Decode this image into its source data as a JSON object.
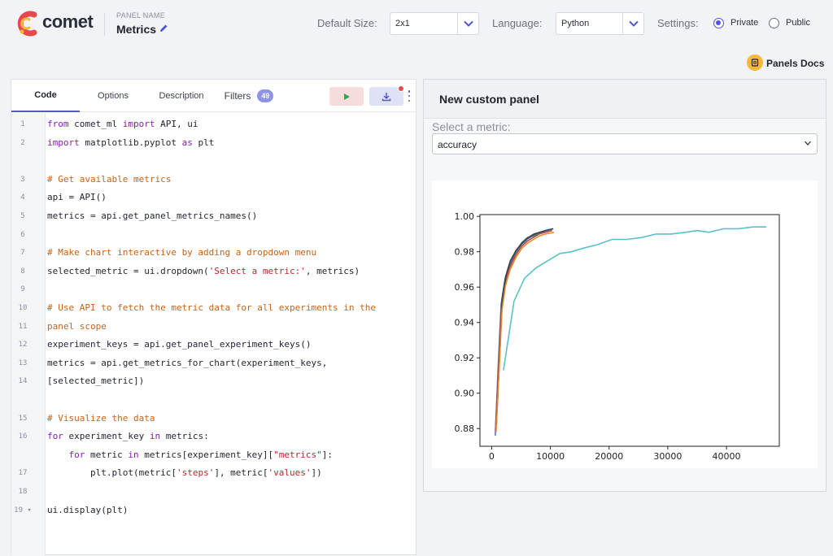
{
  "header": {
    "brand": "comet",
    "panel_name_caption": "PANEL NAME",
    "panel_name": "Metrics",
    "default_size_label": "Default Size:",
    "default_size_value": "2x1",
    "language_label": "Language:",
    "language_value": "Python",
    "settings_label": "Settings:",
    "private_label": "Private",
    "public_label": "Public",
    "visibility_selected": "Private",
    "docs_label": "Panels Docs"
  },
  "editor": {
    "tabs": [
      {
        "label": "Code",
        "active": true
      },
      {
        "label": "Options",
        "active": false
      },
      {
        "label": "Description",
        "active": false
      },
      {
        "label": "Filters",
        "active": false
      }
    ],
    "filters_count": "49",
    "lines": [
      {
        "num": "1",
        "segs": [
          [
            "kw",
            "from"
          ],
          [
            "t",
            " comet_ml "
          ],
          [
            "kw",
            "import"
          ],
          [
            "t",
            " API, ui"
          ]
        ]
      },
      {
        "num": "2",
        "segs": [
          [
            "kw",
            "import"
          ],
          [
            "t",
            " matplotlib.pyplot "
          ],
          [
            "kw",
            "as"
          ],
          [
            "t",
            " plt"
          ]
        ]
      },
      {
        "num": "",
        "segs": []
      },
      {
        "num": "3",
        "segs": [
          [
            "cm",
            "# Get available metrics"
          ]
        ]
      },
      {
        "num": "4",
        "segs": [
          [
            "t",
            "api = API()"
          ]
        ]
      },
      {
        "num": "5",
        "segs": [
          [
            "t",
            "metrics = api.get_panel_metrics_names()"
          ]
        ]
      },
      {
        "num": "6",
        "segs": []
      },
      {
        "num": "7",
        "segs": [
          [
            "cm",
            "# Make chart interactive by adding a dropdown menu"
          ]
        ]
      },
      {
        "num": "8",
        "segs": [
          [
            "t",
            "selected_metric = ui.dropdown("
          ],
          [
            "st",
            "'Select a metric:'"
          ],
          [
            "t",
            ", metrics)"
          ]
        ]
      },
      {
        "num": "9",
        "segs": []
      },
      {
        "num": "10",
        "segs": [
          [
            "cm",
            "# Use API to fetch the metric data for all experiments in the"
          ]
        ]
      },
      {
        "num": "11",
        "segs": [
          [
            "cm",
            "panel scope"
          ]
        ]
      },
      {
        "num": "12",
        "segs": [
          [
            "t",
            "experiment_keys = api.get_panel_experiment_keys()"
          ]
        ]
      },
      {
        "num": "13",
        "segs": [
          [
            "t",
            "metrics = api.get_metrics_for_chart(experiment_keys,"
          ]
        ]
      },
      {
        "num": "14",
        "segs": [
          [
            "t",
            "[selected_metric])"
          ]
        ]
      },
      {
        "num": "",
        "segs": []
      },
      {
        "num": "15",
        "segs": [
          [
            "cm",
            "# Visualize the data"
          ]
        ]
      },
      {
        "num": "16",
        "segs": [
          [
            "kw",
            "for"
          ],
          [
            "t",
            " experiment_key "
          ],
          [
            "kw",
            "in"
          ],
          [
            "t",
            " metrics:"
          ]
        ]
      },
      {
        "num": "",
        "segs": [
          [
            "t",
            "    "
          ],
          [
            "kw",
            "for"
          ],
          [
            "t",
            " metric "
          ],
          [
            "kw",
            "in"
          ],
          [
            "t",
            " metrics[experiment_key]["
          ],
          [
            "st",
            "\"metrics\""
          ],
          [
            "t",
            "]:"
          ]
        ]
      },
      {
        "num": "17",
        "segs": [
          [
            "t",
            "        plt.plot(metric["
          ],
          [
            "st",
            "'steps'"
          ],
          [
            "t",
            "], metric["
          ],
          [
            "st",
            "'values'"
          ],
          [
            "t",
            "])"
          ]
        ]
      },
      {
        "num": "18",
        "segs": []
      },
      {
        "num": "19 ▾",
        "segs": [
          [
            "t",
            "ui.display(plt)"
          ]
        ]
      }
    ]
  },
  "preview": {
    "title": "New custom panel",
    "select_label": "Select a metric:",
    "select_value": "accuracy"
  },
  "chart_data": {
    "type": "line",
    "title": "",
    "xlabel": "",
    "ylabel": "",
    "xlim": [
      -2000,
      49000
    ],
    "ylim": [
      0.87,
      1.001
    ],
    "xticks": [
      0,
      10000,
      20000,
      30000,
      40000
    ],
    "yticks": [
      0.88,
      0.9,
      0.92,
      0.94,
      0.96,
      0.98,
      1.0
    ],
    "legend": "none",
    "grid": false,
    "series": [
      {
        "color": "#5b6bc0",
        "x": [
          600,
          1100,
          1600,
          2200,
          3000,
          4000,
          5000,
          6000,
          7000,
          8000,
          9000,
          10200
        ],
        "y": [
          0.876,
          0.915,
          0.95,
          0.963,
          0.972,
          0.979,
          0.984,
          0.987,
          0.989,
          0.99,
          0.991,
          0.992
        ]
      },
      {
        "color": "#2e7d5b",
        "x": [
          700,
          1200,
          1700,
          2300,
          3100,
          4100,
          5100,
          6100,
          7100,
          8100,
          9100,
          10400
        ],
        "y": [
          0.88,
          0.918,
          0.952,
          0.965,
          0.974,
          0.98,
          0.985,
          0.988,
          0.989,
          0.991,
          0.992,
          0.993
        ]
      },
      {
        "color": "#b04a4a",
        "x": [
          650,
          1150,
          1650,
          2250,
          3050,
          4050,
          5050,
          6050,
          7050,
          8050,
          9050,
          10300
        ],
        "y": [
          0.879,
          0.914,
          0.948,
          0.962,
          0.971,
          0.978,
          0.983,
          0.986,
          0.988,
          0.99,
          0.991,
          0.992
        ]
      },
      {
        "color": "#3a3f55",
        "x": [
          800,
          1300,
          1800,
          2400,
          3200,
          4200,
          5200,
          6200,
          7200,
          8200,
          9200,
          10500
        ],
        "y": [
          0.882,
          0.917,
          0.953,
          0.966,
          0.975,
          0.981,
          0.985,
          0.988,
          0.99,
          0.991,
          0.992,
          0.993
        ]
      },
      {
        "color": "#e08a2c",
        "x": [
          750,
          1250,
          1750,
          2350,
          3150,
          4150,
          5150,
          6150,
          7150,
          8150,
          9150,
          10600
        ],
        "y": [
          0.878,
          0.913,
          0.947,
          0.961,
          0.97,
          0.977,
          0.982,
          0.985,
          0.987,
          0.989,
          0.99,
          0.991
        ]
      },
      {
        "color": "#5bc0c8",
        "x": [
          2000,
          3800,
          5600,
          7600,
          9600,
          11600,
          13600,
          15600,
          18000,
          20500,
          23000,
          25500,
          28000,
          30500,
          33000,
          35000,
          37000,
          39500,
          42000,
          44500,
          46800
        ],
        "y": [
          0.913,
          0.952,
          0.965,
          0.971,
          0.975,
          0.979,
          0.98,
          0.982,
          0.984,
          0.987,
          0.987,
          0.988,
          0.99,
          0.99,
          0.991,
          0.992,
          0.991,
          0.993,
          0.993,
          0.994,
          0.994
        ]
      }
    ]
  }
}
